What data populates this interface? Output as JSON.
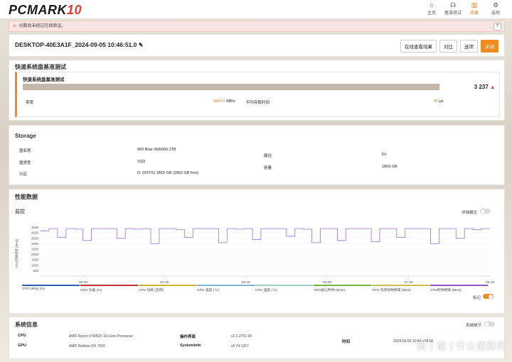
{
  "app": {
    "logo_text": "PCMARK",
    "logo_num": "10"
  },
  "nav": [
    {
      "icon": "home-icon",
      "glyph": "⌂",
      "label": "主页"
    },
    {
      "icon": "headset-icon",
      "glyph": "☊",
      "label": "基准测试"
    },
    {
      "icon": "bar-chart-icon",
      "glyph": "▥",
      "label": "结果",
      "active": true
    },
    {
      "icon": "gear-icon",
      "glyph": "⚙",
      "label": "选项"
    }
  ],
  "warning": {
    "text": "分数尚未经过在线验证。",
    "help": "?"
  },
  "header": {
    "title": "DESKTOP-40E3A1F_2024-09-05 10:46:51.0",
    "buttons": [
      "在线查看结果",
      "对比",
      "选项",
      "关闭"
    ]
  },
  "quick": {
    "section_title": "快速系统盘基准测试",
    "sub_title": "快速系统盘基准测试",
    "score": "3 237",
    "bandwidth_label": "带宽",
    "bandwidth_value": "389.91",
    "bandwidth_unit": "MB/s",
    "latency_label": "平均存取时间",
    "latency_value": "39",
    "latency_unit": "μs"
  },
  "storage": {
    "section_title": "Storage",
    "rows": [
      {
        "k": "盘名称",
        "v": "WD Blue SN5000 2TB"
      },
      {
        "k": "盘类型",
        "v": "SSD"
      },
      {
        "k": "分区",
        "v": "D: (NTFS) 1863 GB (1862 GB free)"
      }
    ],
    "right_rows": [
      {
        "k": "路径",
        "v": "D:\\"
      },
      {
        "k": "容量",
        "v": "1863 GB"
      }
    ]
  },
  "perf": {
    "section_title": "性能数据",
    "monitor_label": "监控",
    "detail_toggle_label": "详细模式",
    "marker_toggle_label": "标记",
    "x_ticks": [
      "00:00",
      "02:30",
      "05:00",
      "06:00",
      "07:30",
      "09:10"
    ],
    "y_ticks": [
      "4500",
      "4000",
      "3500",
      "3000",
      "2500",
      "2000",
      "1500",
      "1000",
      "500"
    ],
    "legend": [
      {
        "label": "CPU Utility (%)",
        "color": "#2f5fb0"
      },
      {
        "label": "GPU 负载 (%)",
        "color": "#c0303a"
      },
      {
        "label": "CPU 功耗 (瓦特)",
        "color": "#c9b832"
      },
      {
        "label": "GPU 温度 (°C)",
        "color": "#7eb7d6"
      },
      {
        "label": "CPU 温度 (°C)",
        "color": "#9fd0c2"
      },
      {
        "label": "GPU核心时钟 (MHz)",
        "color": "#77b23a"
      },
      {
        "label": "GPU 内存时钟频率 (MHz)",
        "color": "#c9c34a"
      },
      {
        "label": "CPU时钟频率 (MHz)",
        "color": "#8f59c4"
      }
    ]
  },
  "chart_data": {
    "type": "line",
    "title": "",
    "xlabel": "",
    "ylabel": "",
    "ylim": [
      0,
      5000
    ],
    "series": [
      {
        "name": "CPU时钟频率 (MHz)",
        "values": [
          4200,
          4400,
          3600,
          4400,
          4350,
          3300,
          4400,
          4400,
          4400,
          3500,
          4400,
          4350,
          4400,
          3000,
          4400,
          4400,
          4300,
          3600,
          4400,
          4400,
          4400,
          3100,
          4400,
          4350,
          4400,
          3400,
          4400,
          4400,
          4400,
          3700,
          4400,
          4350,
          3100,
          4400,
          4400,
          3300,
          4400,
          4400,
          4400,
          3200,
          4400,
          4400,
          3600,
          4400,
          4400,
          4400,
          3000,
          4400,
          4400,
          3500,
          4400,
          4300,
          4400
        ]
      }
    ]
  },
  "sysinfo": {
    "section_title": "系统信息",
    "detail_label": "系统细节",
    "cpu_label": "CPU",
    "cpu_value": "AMD Ryzen 9 5950X 16-Core Processor",
    "gpu_label": "GPU",
    "gpu_value": "AMD Radeon RX 7600",
    "os_label": "操作界面",
    "os_value": "v2.2.2701 64",
    "si_label": "SystemInfo",
    "si_value": "v5.74.1257",
    "time_label": "时间",
    "time_value": "2024-09-05 10:46 +08:00"
  },
  "watermark": "新 | 值 | 什么值得买"
}
